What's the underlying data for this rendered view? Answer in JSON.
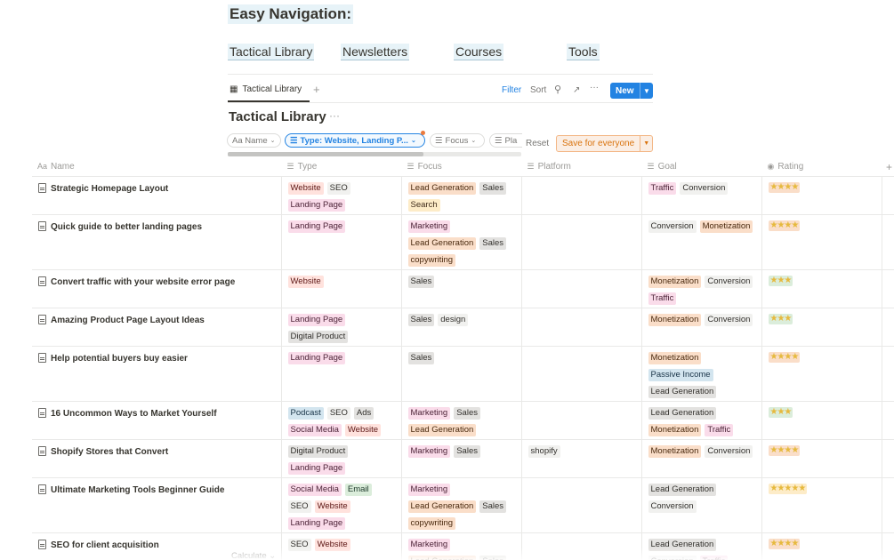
{
  "page": {
    "heading": "Easy Navigation:",
    "nav_links": [
      "Tactical Library",
      "Newsletters",
      "Courses",
      "Tools"
    ]
  },
  "viewbar": {
    "tab_label": "Tactical Library",
    "add_tab": "+",
    "filter": "Filter",
    "sort": "Sort",
    "more": "···",
    "new_label": "New"
  },
  "database": {
    "title": "Tactical Library",
    "more": "···",
    "chips": [
      "Aa Name",
      "Type: Website, Landing P...",
      "Focus",
      "Pla"
    ],
    "reset": "Reset",
    "save": "Save for everyone",
    "calculate": "Calculate"
  },
  "table": {
    "headers": [
      "Name",
      "Type",
      "Focus",
      "Platform",
      "Goal",
      "Rating"
    ],
    "header_icons": [
      "Aa",
      "☰",
      "☰",
      "☰",
      "☰",
      "◉"
    ],
    "rows": [
      {
        "name": "Strategic Homepage Layout",
        "type": [
          "Website",
          "SEO",
          "Landing Page"
        ],
        "focus": [
          "Lead Generation",
          "Sales",
          "Search"
        ],
        "platform": [],
        "goal": [
          "Traffic",
          "Conversion"
        ],
        "rating": 4
      },
      {
        "name": "Quick guide to better landing pages",
        "type": [
          "Landing Page"
        ],
        "focus": [
          "Marketing",
          "Lead Generation",
          "Sales",
          "copywriting"
        ],
        "platform": [],
        "goal": [
          "Conversion",
          "Monetization"
        ],
        "rating": 4
      },
      {
        "name": "Convert traffic with your website error page",
        "type": [
          "Website"
        ],
        "focus": [
          "Sales"
        ],
        "platform": [],
        "goal": [
          "Monetization",
          "Conversion",
          "Traffic"
        ],
        "rating": 3
      },
      {
        "name": "Amazing Product Page Layout Ideas",
        "type": [
          "Landing Page",
          "Digital Product"
        ],
        "focus": [
          "Sales",
          "design"
        ],
        "platform": [],
        "goal": [
          "Monetization",
          "Conversion"
        ],
        "rating": 3
      },
      {
        "name": "Help potential buyers buy easier",
        "type": [
          "Landing Page"
        ],
        "focus": [
          "Sales"
        ],
        "platform": [],
        "goal": [
          "Monetization",
          "Passive Income",
          "Lead Generation"
        ],
        "rating": 4
      },
      {
        "name": "16 Uncommon Ways to Market Yourself",
        "type": [
          "Podcast",
          "SEO",
          "Ads",
          "Social Media",
          "Website"
        ],
        "focus": [
          "Marketing",
          "Sales",
          "Lead Generation"
        ],
        "platform": [],
        "goal": [
          "Lead Generation",
          "Monetization",
          "Traffic"
        ],
        "rating": 3
      },
      {
        "name": "Shopify Stores that Convert",
        "type": [
          "Digital Product",
          "Landing Page"
        ],
        "focus": [
          "Marketing",
          "Sales"
        ],
        "platform": [
          "shopify"
        ],
        "goal": [
          "Monetization",
          "Conversion"
        ],
        "rating": 4
      },
      {
        "name": "Ultimate Marketing Tools Beginner Guide",
        "type": [
          "Social Media",
          "Email",
          "SEO",
          "Website",
          "Landing Page"
        ],
        "focus": [
          "Marketing",
          "Lead Generation",
          "Sales",
          "copywriting"
        ],
        "platform": [],
        "goal": [
          "Lead Generation",
          "Conversion"
        ],
        "rating": 5
      },
      {
        "name": "SEO for client acquisition",
        "type": [
          "SEO",
          "Website"
        ],
        "focus": [
          "Marketing",
          "Lead Generation",
          "Sales"
        ],
        "platform": [],
        "goal": [
          "Lead Generation",
          "Conversion",
          "Traffic"
        ],
        "rating": 4
      }
    ]
  },
  "tag_colors": {
    "Website": [
      "#ffe2dd",
      "#5d1715"
    ],
    "SEO": [
      "#f1f1ef",
      "#32302c"
    ],
    "Landing Page": [
      "#fadcea",
      "#4c2337"
    ],
    "Digital Product": [
      "#e3e2e0",
      "#32302c"
    ],
    "Podcast": [
      "#d3e5ef",
      "#183347"
    ],
    "Ads": [
      "#e3e2e0",
      "#32302c"
    ],
    "Social Media": [
      "#fadcea",
      "#4c2337"
    ],
    "Email": [
      "#dbeddb",
      "#1c3829"
    ],
    "Lead Generation": [
      "#fadec9",
      "#49290e"
    ],
    "Sales": [
      "#e3e2e0",
      "#32302c"
    ],
    "Search": [
      "#fdecc8",
      "#402c1b"
    ],
    "Marketing": [
      "#fadcea",
      "#4c2337"
    ],
    "copywriting": [
      "#fadec9",
      "#49290e"
    ],
    "design": [
      "#f1f1ef",
      "#32302c"
    ],
    "shopify": [
      "#f1f1ef",
      "#32302c"
    ],
    "Traffic": [
      "#fadcea",
      "#4c2337"
    ],
    "Conversion": [
      "#f1f1ef",
      "#32302c"
    ],
    "Monetization": [
      "#fadec9",
      "#49290e"
    ],
    "Passive Income": [
      "#d3e5ef",
      "#183347"
    ],
    "Goal:Lead Generation": [
      "#e3e2e0",
      "#32302c"
    ]
  },
  "rating_colors": {
    "3": "#dbeddb",
    "4": "#fadec9",
    "5": "#fdecc8"
  },
  "accent": "#2383e2"
}
